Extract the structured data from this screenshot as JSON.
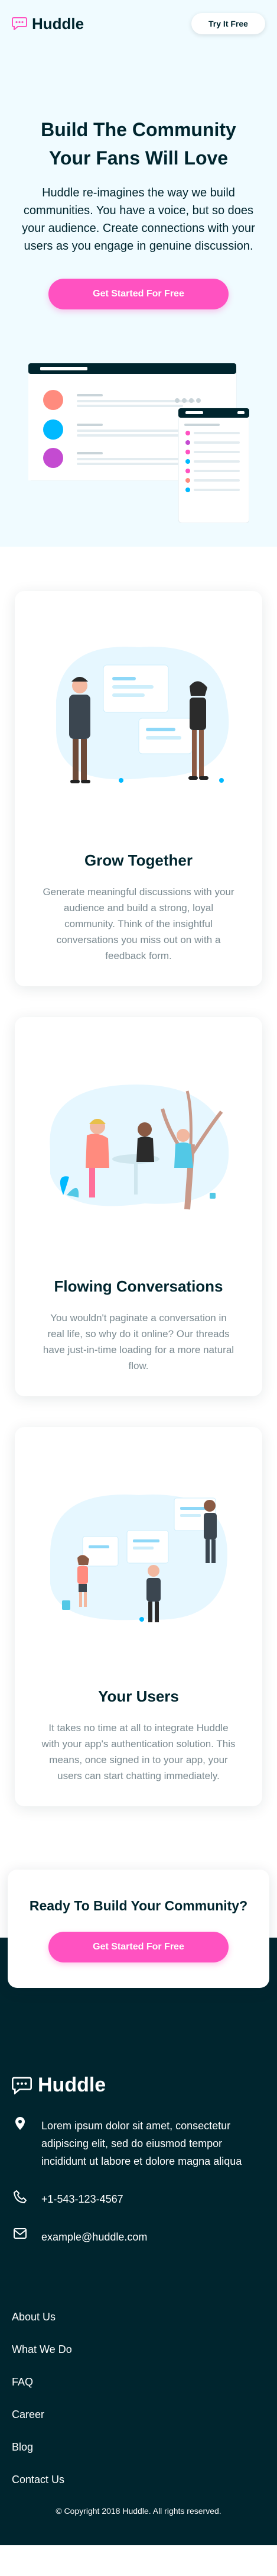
{
  "header": {
    "brand": "Huddle",
    "try_button": "Try It Free"
  },
  "hero": {
    "title": "Build The Community Your Fans Will Love",
    "text": "Huddle re-imagines the way we build communities. You have a voice, but so does your audience. Create connections with your users as you engage in genuine discussion.",
    "cta_label": "Get Started For Free"
  },
  "features": [
    {
      "title": "Grow Together",
      "text": "Generate meaningful discussions with your audience and build a strong, loyal community. Think of the insightful conversations you miss out on with a feedback form.",
      "illustration": "grow-together-illustration"
    },
    {
      "title": "Flowing Conversations",
      "text": "You wouldn't paginate a conversation in real life, so why do it online? Our threads have just-in-time loading for a more natural flow.",
      "illustration": "flowing-conversations-illustration"
    },
    {
      "title": "Your Users",
      "text": "It takes no time at all to integrate Huddle with your app's authentication solution. This means, once signed in to your app, your users can start chatting immediately.",
      "illustration": "your-users-illustration"
    }
  ],
  "cta": {
    "title": "Ready To Build Your Community?",
    "button_label": "Get Started For Free"
  },
  "footer": {
    "brand": "Huddle",
    "address": "Lorem ipsum dolor sit amet, consectetur adipiscing elit, sed do eiusmod tempor incididunt ut labore et dolore magna aliqua",
    "phone": "+1-543-123-4567",
    "email": "example@huddle.com",
    "links": [
      "About Us",
      "What We Do",
      "FAQ",
      "Career",
      "Blog",
      "Contact Us"
    ],
    "copyright": "© Copyright 2018 Huddle. All rights reserved."
  },
  "colors": {
    "primary_dark": "#00252e",
    "accent_pink": "#ff52c1",
    "hero_bg": "#f0fbff",
    "muted_text": "#7b8a91"
  }
}
